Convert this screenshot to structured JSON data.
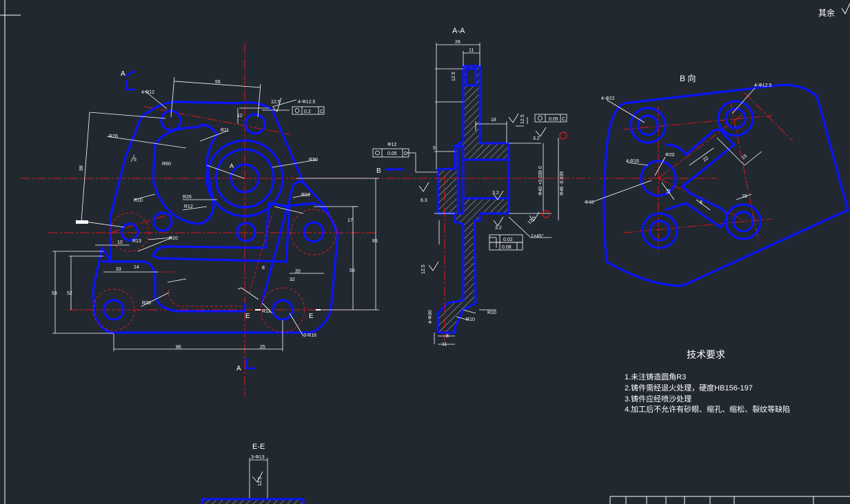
{
  "corner_label": "其余",
  "views": {
    "aa_title": "A-A",
    "b_title": "B 向",
    "ee_title": "E-E",
    "cut_a": "A",
    "cut_e": "E",
    "b_arrow": "B",
    "center_a": "A"
  },
  "tech": {
    "title": "技术要求",
    "items": [
      "1.未注铸造圆角R3",
      "2.铸件需经退火处理，硬度HB156-197",
      "3.铸件应经喷沙处理",
      "4.加工后不允许有砂眼、缩孔、缩松、裂纹等缺陷"
    ]
  },
  "main_dims": {
    "d56": "56",
    "d4r12": "4-R12",
    "r76": "R76",
    "d98": "98",
    "d5": "5",
    "r60": "R60",
    "r11": "R11",
    "r26": "R26",
    "r12": "R12",
    "r10a": "R10",
    "r30": "R30",
    "r10b": "R10",
    "d12": "12",
    "d12_5": "12.5",
    "hole4": "4-Φ12.5",
    "tol": "0.2",
    "datum": "C",
    "d17": "17",
    "d85": "85",
    "d50": "50",
    "d20": "20",
    "d32": "32",
    "d8": "8",
    "d10": "10",
    "d33": "33",
    "d14": "14",
    "r30b": "R30",
    "r13": "R13",
    "r10c": "R10",
    "d53": "53",
    "d52": "52",
    "d86": "86",
    "d25": "25",
    "r3r16": "3-R16",
    "r11b": "R11"
  },
  "aa_dims": {
    "d28": "28",
    "d11": "11",
    "d12_5": "12.5",
    "d18": "18",
    "ra12_5": "12.5",
    "flat": "0.05",
    "datum_c": "C",
    "d3_2": "3.2",
    "phi12": "Φ12",
    "pos": "0.05",
    "datum_d": "D",
    "d5": "5",
    "ra6_3": "6.3",
    "fit1": "Φ40 +0.039 0",
    "fit2": "Φ46 -0.039",
    "ra3_2a": "3.2",
    "ra3_2b": "3.2",
    "ra12_5b": "12.5",
    "chamfer": "1×45°",
    "flat2": "0.02",
    "perp": "0.08",
    "d12_5b": "12.5",
    "hole30": "4-Φ30",
    "r10": "R10",
    "r10b": "R10",
    "d8": "8",
    "d11b": "11"
  },
  "b_dims": {
    "h22": "4-Φ22",
    "h12": "4-Φ12.5",
    "h20": "Φ20",
    "r16": "4-R16",
    "d46": "Φ46",
    "d22": "22",
    "d12": "12",
    "d15": "15",
    "d15b": "15",
    "d8": "8"
  },
  "ee_dims": {
    "h13": "3-Φ13",
    "ra": "12.5"
  }
}
